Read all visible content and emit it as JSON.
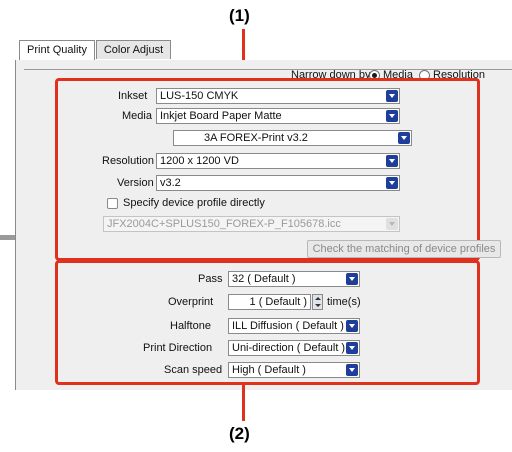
{
  "callouts": {
    "top": "(1)",
    "bottom": "(2)"
  },
  "tabs": [
    {
      "label": "Print Quality",
      "active": true
    },
    {
      "label": "Color Adjust",
      "active": false
    }
  ],
  "narrow_down": {
    "label": "Narrow down by",
    "options": [
      "Media",
      "Resolution"
    ],
    "selected": "Media"
  },
  "profile_section": {
    "inkset": {
      "label": "Inkset",
      "value": "LUS-150 CMYK"
    },
    "media": {
      "label": "Media",
      "value": "Inkjet Board Paper Matte"
    },
    "profile": {
      "value": "3A FOREX-Print v3.2"
    },
    "resolution": {
      "label": "Resolution",
      "value": "1200 x 1200 VD"
    },
    "version": {
      "label": "Version",
      "value": "v3.2"
    },
    "specify_profile": {
      "label": "Specify device profile directly",
      "checked": false
    },
    "profile_file": {
      "value": "JFX2004C+SPLUS150_FOREX-P_F105678.icc"
    },
    "check_button": "Check the matching of device profiles"
  },
  "print_section": {
    "pass": {
      "label": "Pass",
      "value": "32 ( Default )"
    },
    "overprint": {
      "label": "Overprint",
      "value": "1 ( Default )",
      "unit": "time(s)"
    },
    "halftone": {
      "label": "Halftone",
      "value": "ILL Diffusion ( Default )"
    },
    "print_direction": {
      "label": "Print Direction",
      "value": "Uni-direction ( Default )"
    },
    "scan_speed": {
      "label": "Scan speed",
      "value": "High ( Default )"
    }
  },
  "colors": {
    "accent_red": "#e0301e",
    "dropdown_arrow": "#1f3e9c"
  }
}
